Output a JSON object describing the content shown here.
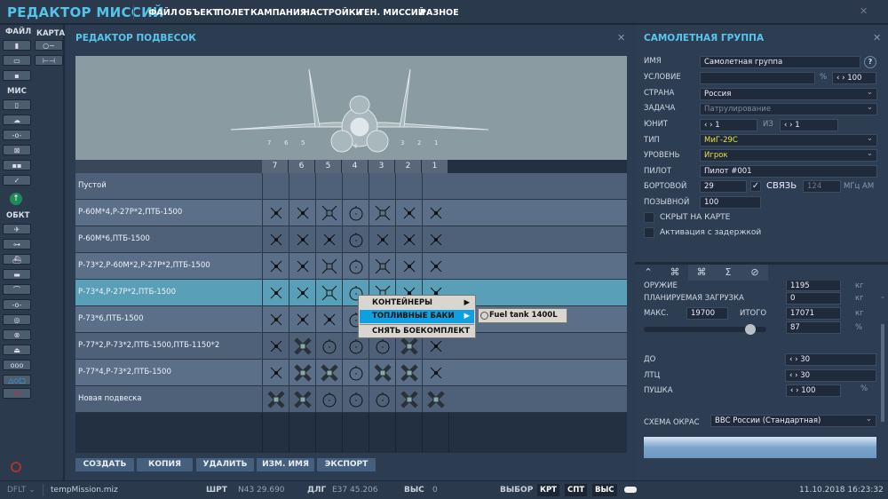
{
  "app": {
    "title": "РЕДАКТОР МИССИЙ",
    "menu": [
      "ФАЙЛ",
      "ОБЪЕКТ",
      "ПОЛЕТ",
      "КАМПАНИЯ",
      "НАСТРОЙКИ",
      "ГЕН. МИССИЙ",
      "РАЗНОЕ"
    ]
  },
  "leftbar": {
    "file": "ФАЙЛ",
    "map": "КАРТА",
    "mis": "МИС",
    "obj": "ОБКТ"
  },
  "loadout": {
    "title": "РЕДАКТОР ПОДВЕСОК",
    "pylons": [
      "7",
      "6",
      "5",
      "4",
      "3",
      "2",
      "1"
    ],
    "rows": [
      {
        "name": "Пустой",
        "icons": [
          "",
          "",
          "",
          "",
          "",
          "",
          ""
        ]
      },
      {
        "name": "Р-60М*4,Р-27Р*2,ПТБ-1500",
        "icons": [
          "x",
          "x",
          "xo",
          "tank",
          "xo",
          "x",
          "x"
        ]
      },
      {
        "name": "Р-60М*6,ПТБ-1500",
        "icons": [
          "x",
          "x",
          "x",
          "tank",
          "x",
          "x",
          "x"
        ]
      },
      {
        "name": "Р-73*2,Р-60М*2,Р-27Р*2,ПТБ-1500",
        "icons": [
          "x",
          "x",
          "xo",
          "tank",
          "xo",
          "x",
          "x"
        ]
      },
      {
        "name": "Р-73*4,Р-27Р*2,ПТБ-1500",
        "icons": [
          "x",
          "x",
          "xo",
          "tank",
          "xo",
          "x",
          "x"
        ],
        "selected": true
      },
      {
        "name": "Р-73*6,ПТБ-1500",
        "icons": [
          "x",
          "x",
          "x",
          "tank",
          "x",
          "x",
          "x"
        ]
      },
      {
        "name": "Р-77*2,Р-73*2,ПТБ-1500,ПТБ-1150*2",
        "icons": [
          "x",
          "big",
          "tank",
          "tank",
          "tank",
          "big",
          "x"
        ]
      },
      {
        "name": "Р-77*4,Р-73*2,ПТБ-1500",
        "icons": [
          "x",
          "big",
          "big",
          "tank",
          "big",
          "big",
          "x"
        ]
      },
      {
        "name": "Новая подвеска",
        "icons": [
          "big",
          "big",
          "tank",
          "tank",
          "tank",
          "big",
          "big"
        ]
      }
    ],
    "buttons": {
      "create": "СОЗДАТЬ",
      "copy": "КОПИЯ",
      "delete": "УДАЛИТЬ",
      "rename": "ИЗМ. ИМЯ",
      "export": "ЭКСПОРТ"
    },
    "context_menu": {
      "containers": "КОНТЕЙНЕРЫ",
      "fuel_tanks": "ТОПЛИВНЫЕ БАКИ",
      "remove": "СНЯТЬ БОЕКОМПЛЕКТ",
      "submenu_item": "Fuel tank 1400L"
    }
  },
  "group": {
    "title": "САМОЛЕТНАЯ ГРУППА",
    "name_label": "ИМЯ",
    "name": "Самолетная группа",
    "condition_label": "УСЛОВИЕ",
    "condition": "",
    "percent_sign": "%",
    "condition_pct": "100",
    "country_label": "СТРАНА",
    "country": "Россия",
    "task_label": "ЗАДАЧА",
    "task": "Патрулирование",
    "unit_label": "ЮНИТ",
    "unit": "1",
    "of_label": "ИЗ",
    "unit_total": "1",
    "type_label": "ТИП",
    "type": "МиГ-29С",
    "skill_label": "УРОВЕНЬ",
    "skill": "Игрок",
    "pilot_label": "ПИЛОТ",
    "pilot": "Пилот #001",
    "tail_label": "БОРТОВОЙ",
    "tail": "29",
    "radio_label": "СВЯЗЬ",
    "radio_freq": "124",
    "radio_unit": "МГц AM",
    "callsign_label": "ПОЗЫВНОЙ",
    "callsign": "100",
    "hidden_label": "СКРЫТ НА КАРТЕ",
    "late_label": "Активация с задержкой"
  },
  "payload": {
    "weapons_label": "ОРУЖИЕ",
    "weapons": "1195",
    "kg": "кг",
    "planned_label": "ПЛАНИРУЕМАЯ ЗАГРУЗКА",
    "planned": "0",
    "max_label": "МАКС.",
    "max": "19700",
    "total_label": "ИТОГО",
    "total": "17071",
    "fuel_pct": "87",
    "pct": "%",
    "fuel_fraction": 0.87,
    "chaff_label": "ДО",
    "chaff": "30",
    "flare_label": "ЛТЦ",
    "flare": "30",
    "gun_label": "ПУШКА",
    "gun": "100",
    "livery_label": "СХЕМА ОКРАС",
    "livery": "ВВС России (Стандартная)"
  },
  "status": {
    "profile": "DFLT",
    "file": "tempMission.miz",
    "lat_label": "ШРТ",
    "lat": "N43 29.690",
    "lon_label": "ДЛГ",
    "lon": "E37 45.206",
    "alt_label": "ВЫС",
    "alt": "0",
    "select_label": "ВЫБОР",
    "sel1": "КРТ",
    "sel2": "СПТ",
    "sel3": "ВЫС",
    "datetime": "11.10.2018 16:23:32"
  }
}
